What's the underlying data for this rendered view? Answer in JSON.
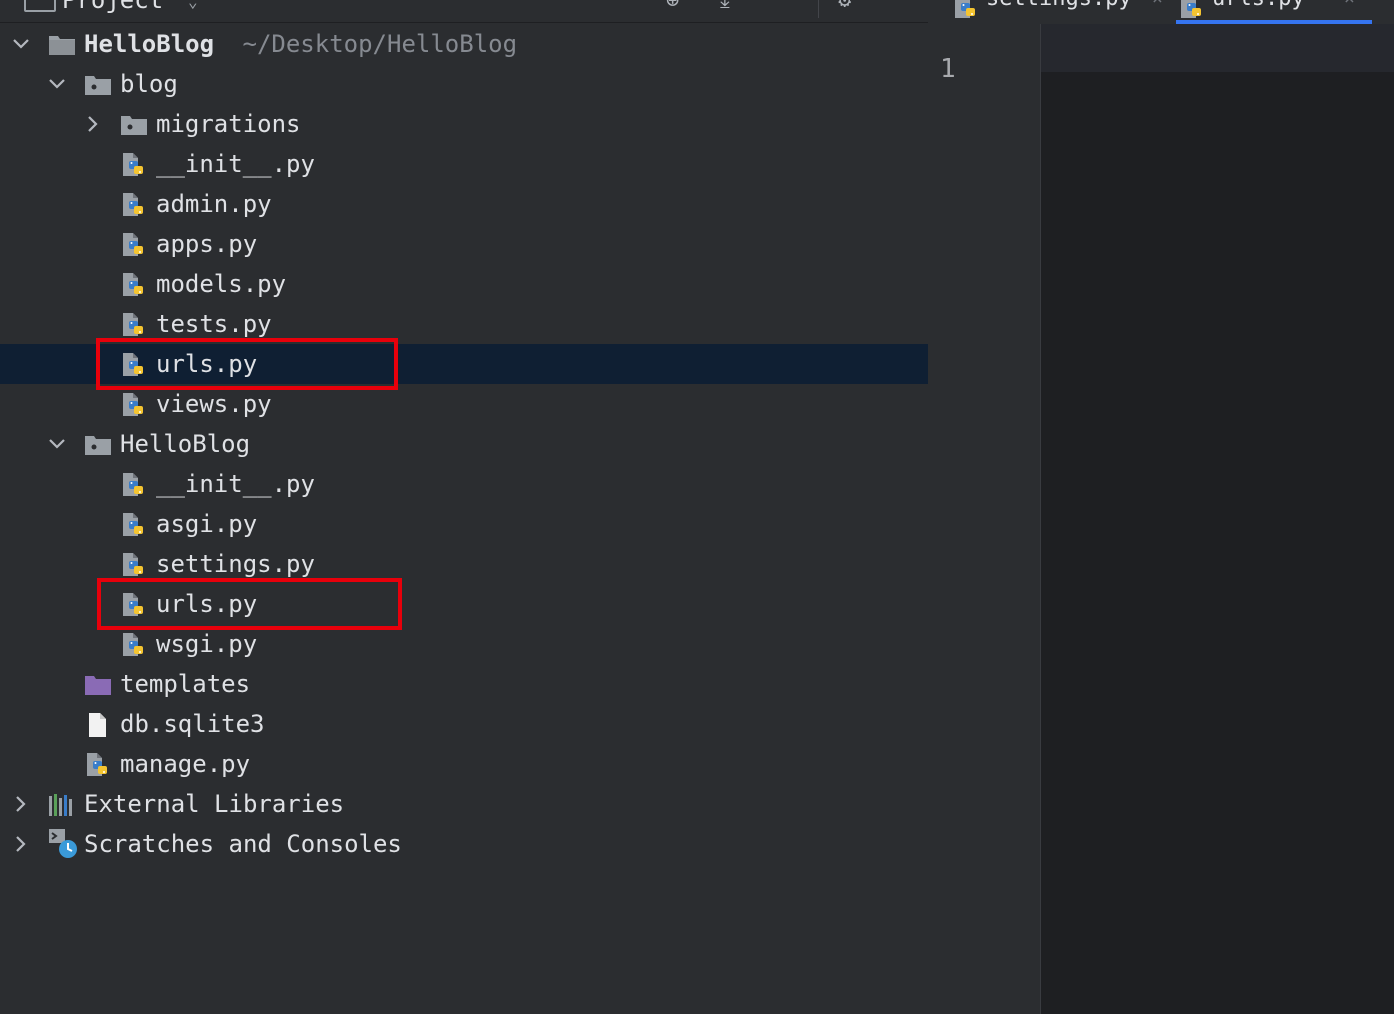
{
  "toolwindow": {
    "title": "Project"
  },
  "tree": [
    {
      "label": "HelloBlog",
      "path": "~/Desktop/HelloBlog",
      "depth": 0,
      "arrow": "down",
      "icon": "module-folder-icon",
      "bold": true
    },
    {
      "label": "blog",
      "depth": 1,
      "arrow": "down",
      "icon": "package-folder-icon"
    },
    {
      "label": "migrations",
      "depth": 2,
      "arrow": "right",
      "icon": "package-folder-icon"
    },
    {
      "label": "__init__.py",
      "depth": 2,
      "icon": "python-file-icon"
    },
    {
      "label": "admin.py",
      "depth": 2,
      "icon": "python-file-icon"
    },
    {
      "label": "apps.py",
      "depth": 2,
      "icon": "python-file-icon"
    },
    {
      "label": "models.py",
      "depth": 2,
      "icon": "python-file-icon"
    },
    {
      "label": "tests.py",
      "depth": 2,
      "icon": "python-file-icon"
    },
    {
      "label": "urls.py",
      "depth": 2,
      "icon": "python-file-icon",
      "selected": true,
      "highlighted": true
    },
    {
      "label": "views.py",
      "depth": 2,
      "icon": "python-file-icon"
    },
    {
      "label": "HelloBlog",
      "depth": 1,
      "arrow": "down",
      "icon": "package-folder-icon"
    },
    {
      "label": "__init__.py",
      "depth": 2,
      "icon": "python-file-icon"
    },
    {
      "label": "asgi.py",
      "depth": 2,
      "icon": "python-file-icon"
    },
    {
      "label": "settings.py",
      "depth": 2,
      "icon": "python-file-icon"
    },
    {
      "label": "urls.py",
      "depth": 2,
      "icon": "python-file-icon",
      "highlighted": true
    },
    {
      "label": "wsgi.py",
      "depth": 2,
      "icon": "python-file-icon"
    },
    {
      "label": "templates",
      "depth": 1,
      "icon": "templates-folder-icon"
    },
    {
      "label": "db.sqlite3",
      "depth": 1,
      "icon": "generic-file-icon"
    },
    {
      "label": "manage.py",
      "depth": 1,
      "icon": "python-file-icon"
    },
    {
      "label": "External Libraries",
      "depth": 0,
      "arrow": "right",
      "icon": "libraries-icon"
    },
    {
      "label": "Scratches and Consoles",
      "depth": 0,
      "arrow": "right",
      "icon": "scratches-icon"
    }
  ],
  "editor": {
    "tabs": [
      {
        "label": "settings.py",
        "active": false
      },
      {
        "label": "urls.py",
        "active": true
      }
    ],
    "line_numbers": [
      "1"
    ]
  },
  "colors": {
    "selection": "#0f1f33",
    "highlight_box": "#e8000b",
    "active_tab": "#3574f0"
  }
}
